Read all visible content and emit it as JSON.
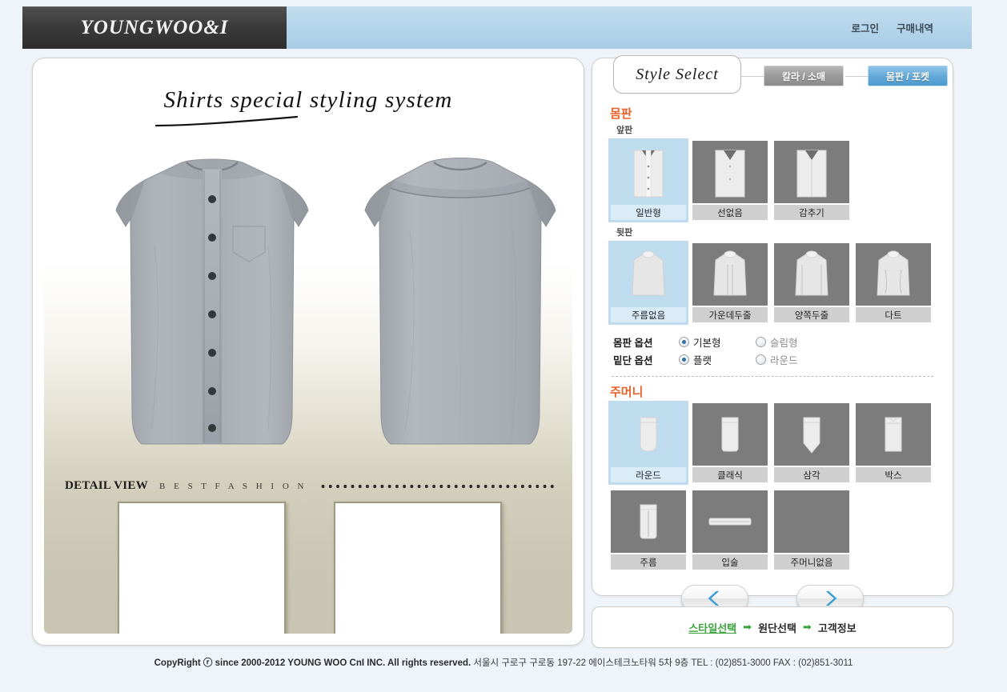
{
  "header": {
    "logo": "YOUNGWOO&I",
    "nav": [
      {
        "label": "로그인",
        "name": "login-link"
      },
      {
        "label": "구매내역",
        "name": "purchase-history-link"
      }
    ]
  },
  "preview": {
    "title": "Shirts special styling system",
    "detail_view_label": "DETAIL VIEW",
    "best_fashion_label": "B E S T   F A S H I O N",
    "shirt_color": "#a9aeb4",
    "background_top": "#ffffff",
    "background_bottom": "#c9c5b2"
  },
  "style_panel": {
    "header_label": "Style  Select",
    "tabs": [
      {
        "label": "칼라 / 소매",
        "active": false,
        "color": "#9a9a9a"
      },
      {
        "label": "몸판 / 포켓",
        "active": true,
        "color": "#4e9bcf"
      }
    ],
    "body_section": {
      "title": "몸판",
      "front_label": "앞판",
      "front_options": [
        {
          "label": "일반형",
          "selected": true
        },
        {
          "label": "선없음",
          "selected": false
        },
        {
          "label": "감추기",
          "selected": false
        }
      ],
      "back_label": "뒷판",
      "back_options": [
        {
          "label": "주름없음",
          "selected": true
        },
        {
          "label": "가운데두줄",
          "selected": false
        },
        {
          "label": "양쪽두줄",
          "selected": false
        },
        {
          "label": "다트",
          "selected": false
        }
      ],
      "radio_groups": [
        {
          "title": "몸판 옵션",
          "items": [
            {
              "label": "기본형",
              "selected": true
            },
            {
              "label": "슬림형",
              "selected": false
            }
          ]
        },
        {
          "title": "밑단 옵션",
          "items": [
            {
              "label": "플랫",
              "selected": true
            },
            {
              "label": "라운드",
              "selected": false
            }
          ]
        }
      ]
    },
    "pocket_section": {
      "title": "주머니",
      "row1": [
        {
          "label": "라운드",
          "selected": true
        },
        {
          "label": "클래식",
          "selected": false
        },
        {
          "label": "삼각",
          "selected": false
        },
        {
          "label": "박스",
          "selected": false
        }
      ],
      "row2": [
        {
          "label": "주름",
          "selected": false
        },
        {
          "label": "입술",
          "selected": false
        },
        {
          "label": "주머니없음",
          "selected": false
        }
      ]
    },
    "nav_buttons": [
      {
        "name": "prev-button",
        "icon": "chevron-left-icon"
      },
      {
        "name": "next-button",
        "icon": "chevron-right-icon"
      }
    ]
  },
  "steps": {
    "items": [
      {
        "label": "스타일선택",
        "active": true
      },
      {
        "label": "원단선택",
        "active": false
      },
      {
        "label": "고객정보",
        "active": false
      }
    ],
    "arrow": "➡"
  },
  "footer": {
    "copyright": "CopyRight ⓡ since 2000-2012 YOUNG WOO CnI INC. All rights reserved.",
    "address": "서울시 구로구 구로동 197-22 에이스테크노타워 5차 9층 TEL : (02)851-3000 FAX : (02)851-3011"
  }
}
